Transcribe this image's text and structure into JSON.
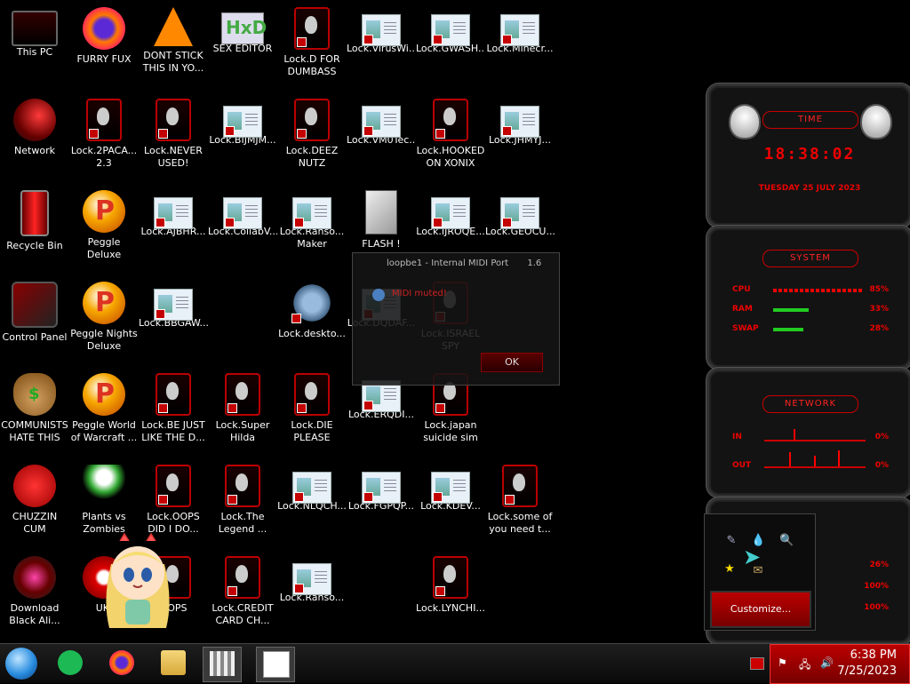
{
  "desktop_icons": [
    {
      "label": "This PC",
      "art": "monitor"
    },
    {
      "label": "FURRY FUX",
      "art": "firefox"
    },
    {
      "label": "DONT STICK\nTHIS IN YO...",
      "art": "vlc-cone"
    },
    {
      "label": "SEX EDITOR",
      "art": "hxd"
    },
    {
      "label": "Lock.D FOR\nDUMBASS",
      "art": "alien"
    },
    {
      "label": "Lock.VirusWi...",
      "art": "window"
    },
    {
      "label": "Lock.GWASH...",
      "art": "window"
    },
    {
      "label": "Lock.Minecr...",
      "art": "window"
    },
    {
      "label": "Network",
      "art": "network"
    },
    {
      "label": "Lock.2PACA...\n2.3",
      "art": "alien"
    },
    {
      "label": "Lock.NEVER\nUSED!",
      "art": "alien"
    },
    {
      "label": "Lock.BIJMJM...",
      "art": "window"
    },
    {
      "label": "Lock.DEEZ\nNUTZ",
      "art": "alien"
    },
    {
      "label": "Lock.VM0Tec...",
      "art": "window"
    },
    {
      "label": "Lock.HOOKED\nON XONIX",
      "art": "alien"
    },
    {
      "label": "Lock.JHMYJ...",
      "art": "window"
    },
    {
      "label": "Recycle Bin",
      "art": "bin"
    },
    {
      "label": "Peggle Deluxe",
      "art": "peggle"
    },
    {
      "label": "Lock.AJBHR...",
      "art": "window"
    },
    {
      "label": "Lock.CollabV...",
      "art": "window"
    },
    {
      "label": "Lock.Ranso...\nMaker Builde...",
      "art": "window"
    },
    {
      "label": "FLASH !",
      "art": "flash"
    },
    {
      "label": "Lock.IJROQE...",
      "art": "window"
    },
    {
      "label": "Lock.GEOCU...",
      "art": "window"
    },
    {
      "label": "Control Panel",
      "art": "control"
    },
    {
      "label": "Peggle Nights\nDeluxe",
      "art": "peggle"
    },
    {
      "label": "Lock.BBGAW...",
      "art": "window"
    },
    {
      "label": "Lock.deskto...",
      "art": "gear"
    },
    {
      "label": "Lock.DQDAF...",
      "art": "window"
    },
    {
      "label": "Lock.ISRAEL\nSPY",
      "art": "alien"
    },
    {
      "label": "COMMUNISTS\nHATE THIS G...",
      "art": "money"
    },
    {
      "label": "Peggle World\nof Warcraft ...",
      "art": "peggle"
    },
    {
      "label": "Lock.BE JUST\nLIKE THE D...",
      "art": "alien"
    },
    {
      "label": "Lock.Super\nHilda",
      "art": "alien"
    },
    {
      "label": "Lock.DIE\nPLEASE",
      "art": "alien"
    },
    {
      "label": "Lock.ERQDI...",
      "art": "window"
    },
    {
      "label": "Lock.japan\nsuicide sim",
      "art": "alien"
    },
    {
      "label": "CHUZZIN\nCUM",
      "art": "chuzzle"
    },
    {
      "label": "Plants vs\nZombies",
      "art": "plant"
    },
    {
      "label": "Lock.OOPS\nDID I DO...",
      "art": "alien"
    },
    {
      "label": "Lock.The\nLegend ...",
      "art": "alien"
    },
    {
      "label": "Lock.NLQCH...",
      "art": "window"
    },
    {
      "label": "Lock.FGPQP...",
      "art": "window"
    },
    {
      "label": "Lock.KDEV...",
      "art": "window"
    },
    {
      "label": "Lock.some of\nyou need t...",
      "art": "alien"
    },
    {
      "label": "Download\nBlack Ali...",
      "art": "blackali"
    },
    {
      "label": "UKI",
      "art": "uki"
    },
    {
      "label": "OOPS",
      "art": "alien"
    },
    {
      "label": "Lock.CREDIT\nCARD CH...",
      "art": "alien"
    },
    {
      "label": "Lock.Ranso...",
      "art": "window"
    },
    {
      "label": "Lock.LYNCHI...",
      "art": "alien"
    }
  ],
  "midi_dialog": {
    "title": "loopbe1 - Internal MIDI Port",
    "version": "1.6",
    "message": "MIDI muted!",
    "ok_label": "OK"
  },
  "gadgets": {
    "time": {
      "title": "TIME",
      "clock": "18:38:02",
      "date": "TUESDAY 25 JULY 2023"
    },
    "system": {
      "title": "SYSTEM",
      "rows": [
        {
          "label": "CPU",
          "value": "85%",
          "level": 0.85
        },
        {
          "label": "RAM",
          "value": "33%",
          "level": 0.33
        },
        {
          "label": "SWAP",
          "value": "28%",
          "level": 0.28
        }
      ]
    },
    "network": {
      "title": "NETWORK",
      "rows": [
        {
          "label": "IN",
          "value": "0%"
        },
        {
          "label": "OUT",
          "value": "0%"
        }
      ]
    },
    "disks": {
      "rows": [
        {
          "value": "26%"
        },
        {
          "value": "100%"
        },
        {
          "value": "100%"
        }
      ]
    }
  },
  "tray_popup": {
    "customize_label": "Customize..."
  },
  "taskbar": {
    "apps": [
      "start-orb",
      "spotify",
      "firefox",
      "file-explorer",
      "pixel-game",
      "text-document"
    ],
    "clock_time": "6:38 PM",
    "clock_date": "7/25/2023"
  },
  "colors": {
    "accent": "#cc0000",
    "tray": "#b00000"
  }
}
